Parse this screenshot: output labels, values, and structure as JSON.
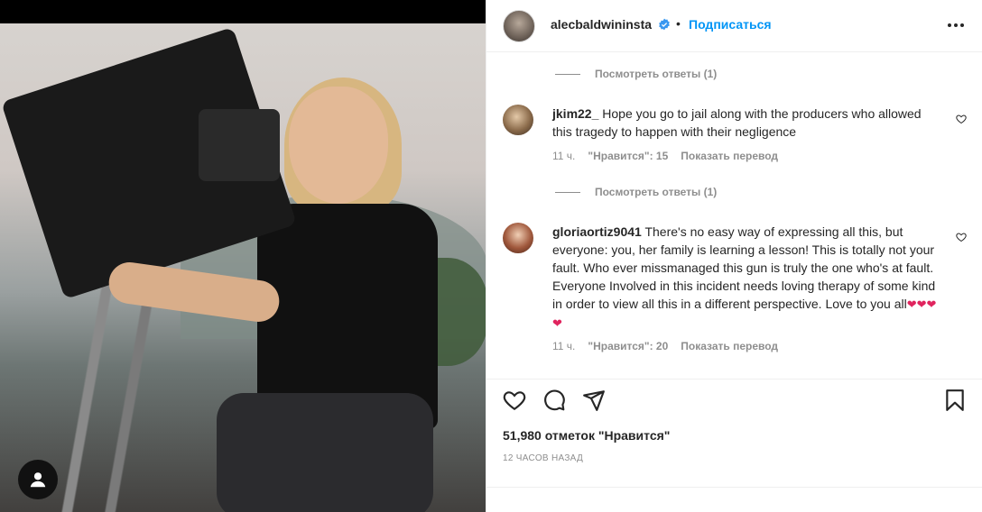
{
  "post": {
    "author": "alecbaldwininsta",
    "follow_label": "Подписаться",
    "dot": "•"
  },
  "comments": {
    "replies_1": "Посмотреть ответы (1)",
    "replies_2": "Посмотреть ответы (1)",
    "items": [
      {
        "user": "jkim22_",
        "text": " Hope you go to jail along with the producers who allowed this tragedy to happen with their negligence",
        "time": "11 ч.",
        "likes": "\"Нравится\": 15",
        "translate": "Показать перевод"
      },
      {
        "user": "gloriaortiz9041",
        "text": " There's no easy way of expressing all this, but everyone: you, her family is learning a lesson! This is totally not your fault. Who ever missmanaged this gun is truly the one who's at fault. Everyone Involved in this incident needs loving therapy of some kind in order to view all this in a different perspective. Love to you all",
        "hearts": "❤❤❤❤",
        "time": "11 ч.",
        "likes": "\"Нравится\": 20",
        "translate": "Показать перевод"
      }
    ]
  },
  "footer": {
    "likes_text": "51,980 отметок \"Нравится\"",
    "time_text": "12 ЧАСОВ НАЗАД"
  },
  "colors": {
    "accent": "#0095f6",
    "text": "#262626",
    "muted": "#8e8e8e",
    "heart": "#e0245e"
  },
  "icons": [
    "user-tag-icon",
    "verified-badge-icon",
    "more-options-icon",
    "like-icon",
    "comment-icon",
    "share-icon",
    "save-icon",
    "comment-like-icon"
  ]
}
